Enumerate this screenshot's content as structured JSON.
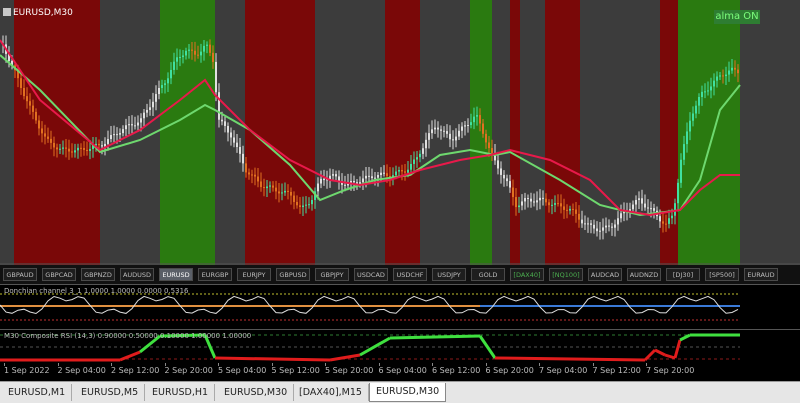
{
  "chart": {
    "symbol_label": "EURUSD,M30",
    "badge": "alma ON",
    "colors": {
      "bull_zone": "#2a7a10",
      "bear_zone": "#7a0808",
      "neutral_zone": "#3c3c3c",
      "bull_candle": "#40e0a0",
      "bear_candle": "#e07020",
      "neutral_candle": "#e0e0e0",
      "ma_fast": "#e8194a",
      "ma_slow": "#6ed86e"
    }
  },
  "symbol_buttons": [
    {
      "label": "GBPAUD"
    },
    {
      "label": "GBPCAD"
    },
    {
      "label": "GBPNZD"
    },
    {
      "label": "AUDUSD"
    },
    {
      "label": "EURUSD",
      "active": true
    },
    {
      "label": "EURGBP"
    },
    {
      "label": "EURJPY"
    },
    {
      "label": "GBPUSD"
    },
    {
      "label": "GBPJPY"
    },
    {
      "label": "USDCAD"
    },
    {
      "label": "USDCHF"
    },
    {
      "label": "USDJPY"
    },
    {
      "label": "GOLD"
    },
    {
      "label": "[DAX40]",
      "green": true
    },
    {
      "label": "[NQ100]",
      "green": true
    },
    {
      "label": "AUDCAD"
    },
    {
      "label": "AUDNZD"
    },
    {
      "label": "[DJ30]"
    },
    {
      "label": "[SP500]"
    },
    {
      "label": "EURAUD"
    }
  ],
  "donchian": {
    "label": "Donchian channel 3_1 1.0000 1.0000 0.0000 0.5316"
  },
  "rsi": {
    "label": "M30 Composite RSI (14,3) 0.90000 0.50000 0.10000 1.00000 1.00000"
  },
  "time_axis": [
    "1 Sep 2022",
    "2 Sep 04:00",
    "2 Sep 12:00",
    "2 Sep 20:00",
    "5 Sep 04:00",
    "5 Sep 12:00",
    "5 Sep 20:00",
    "6 Sep 04:00",
    "6 Sep 12:00",
    "6 Sep 20:00",
    "7 Sep 04:00",
    "7 Sep 12:00",
    "7 Sep 20:00"
  ],
  "tabs": [
    {
      "label": "EURUSD,M1"
    },
    {
      "label": "EURUSD,M5"
    },
    {
      "label": "EURUSD,H1"
    },
    {
      "label": "EURUSD,M30"
    },
    {
      "label": "[DAX40],M15"
    },
    {
      "label": "EURUSD,M30",
      "active": true
    }
  ]
}
